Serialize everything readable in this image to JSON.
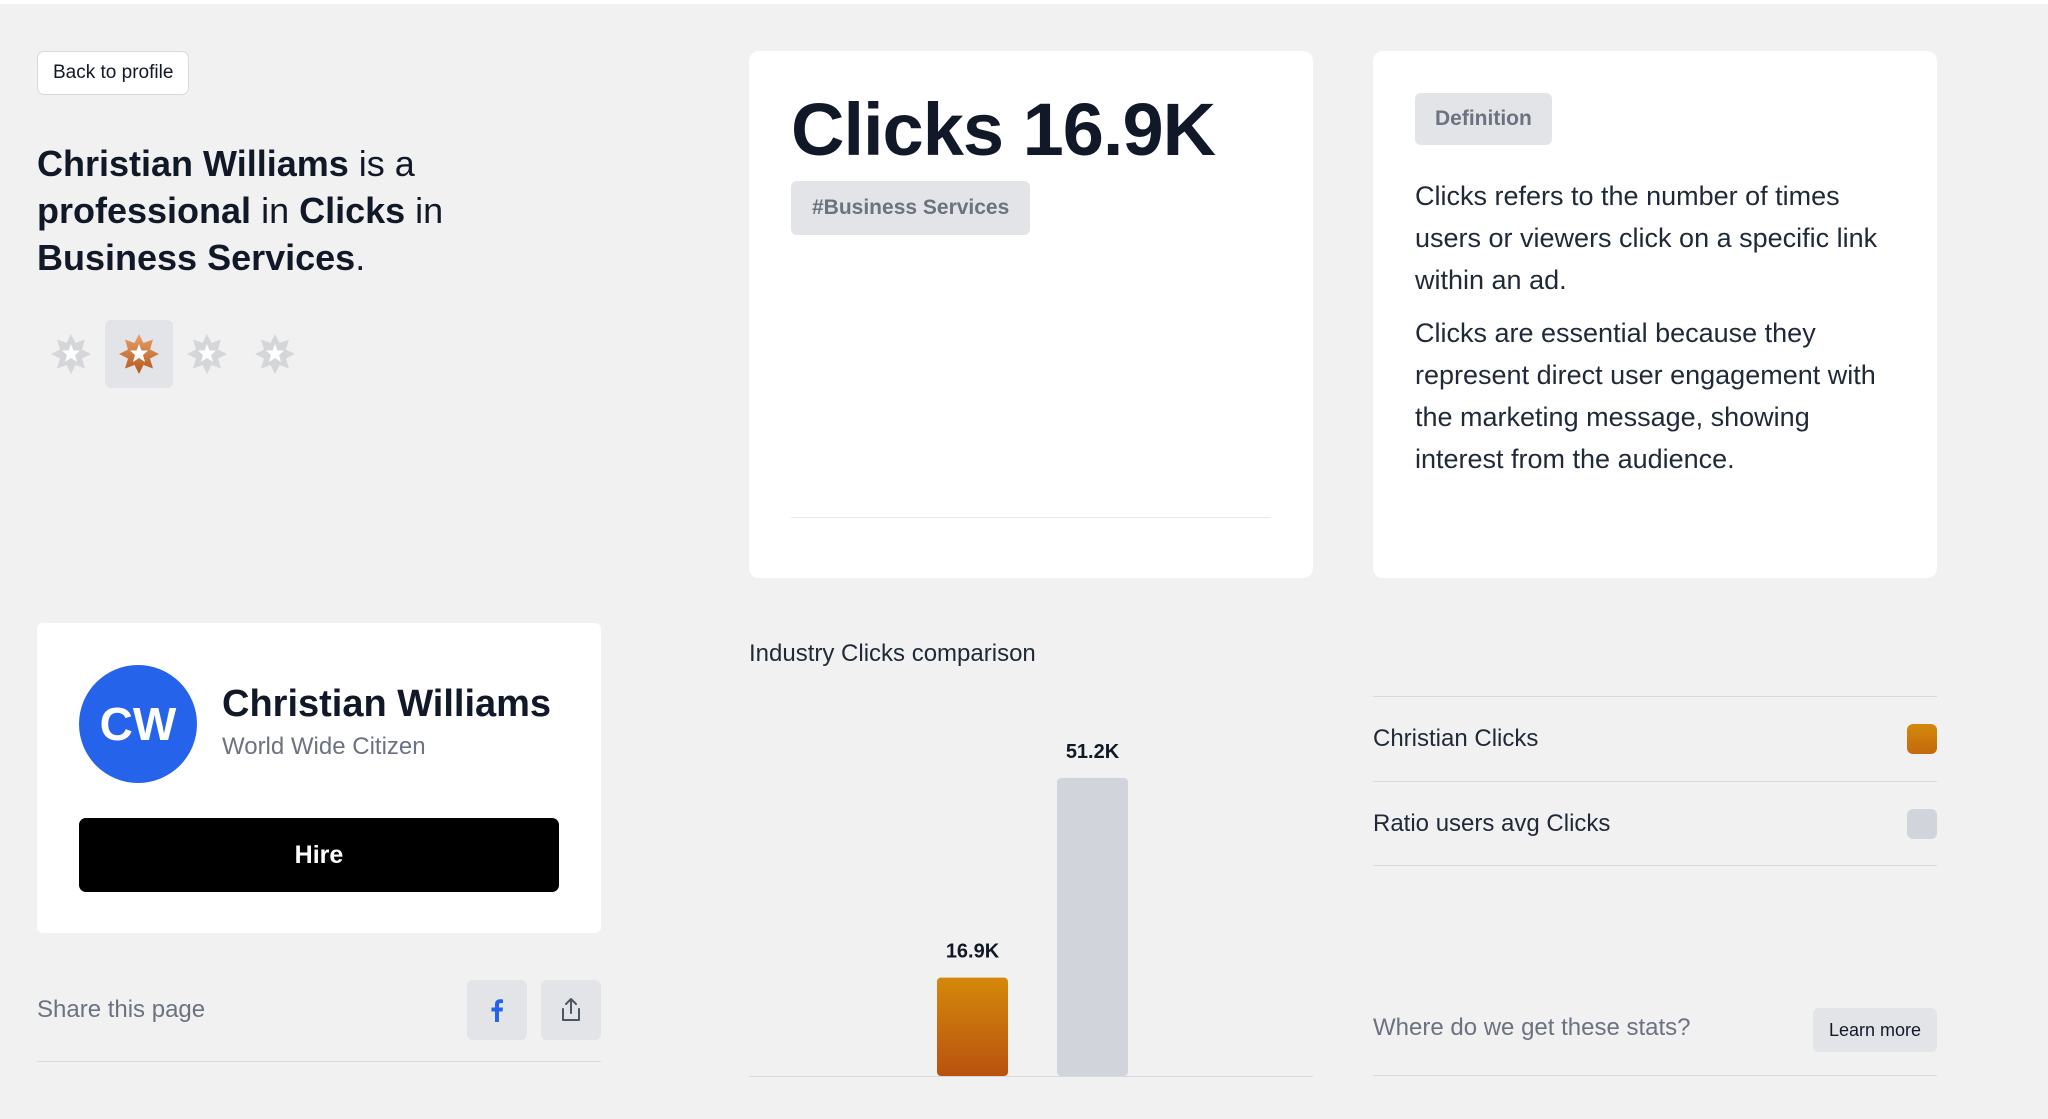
{
  "nav": {
    "back_label": "Back to profile"
  },
  "headline": {
    "name": "Christian Williams",
    "is_a": " is a ",
    "level": "professional",
    "in1": " in ",
    "metric": "Clicks",
    "in2": " in ",
    "industry": "Business Services",
    "end": "."
  },
  "rating": {
    "stars_total": 4,
    "active_index": 1
  },
  "profile": {
    "initials": "CW",
    "name": "Christian Williams",
    "subtitle": "World Wide Citizen",
    "hire_label": "Hire"
  },
  "share": {
    "label": "Share this page",
    "icons": [
      "facebook-icon",
      "share-icon"
    ]
  },
  "stat": {
    "title": "Clicks 16.9K",
    "tag": "#Business Services"
  },
  "definition": {
    "badge": "Definition",
    "para1": "Clicks refers to the number of times users or viewers click on a specific link within an ad.",
    "para2": "Clicks are essential because they represent direct user engagement with the marketing message, showing interest from the audience."
  },
  "chart_title": "Industry Clicks comparison",
  "chart_data": {
    "type": "bar",
    "categories": [
      "Christian Clicks",
      "Ratio users avg Clicks"
    ],
    "values": [
      16.9,
      51.2
    ],
    "value_labels": [
      "16.9K",
      "51.2K"
    ],
    "unit": "K",
    "colors": [
      "#c2690e",
      "#d1d5db"
    ],
    "ylim": [
      0,
      51.2
    ]
  },
  "legend": [
    {
      "label": "Christian Clicks",
      "color": "#d4890a"
    },
    {
      "label": "Ratio users avg Clicks",
      "color": "#d1d5db"
    }
  ],
  "stats_source": {
    "question": "Where do we get these stats?",
    "learn_label": "Learn more"
  }
}
